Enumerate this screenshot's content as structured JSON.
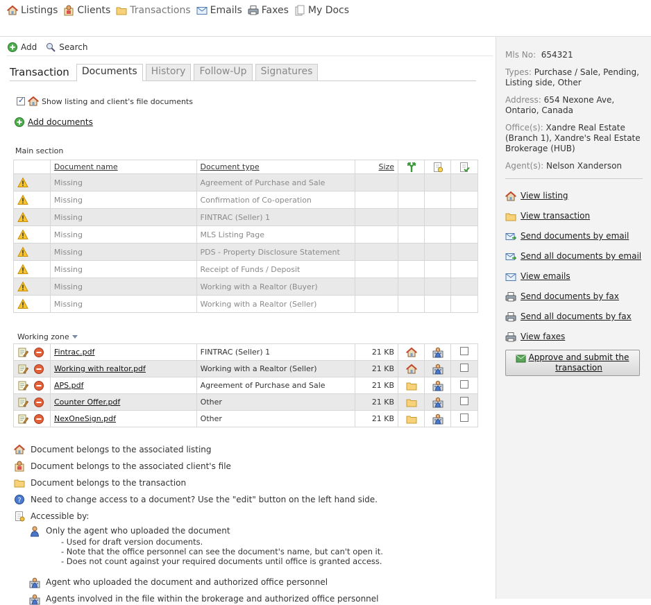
{
  "nav": {
    "items": [
      {
        "label": "Listings",
        "icon": "house-icon"
      },
      {
        "label": "Clients",
        "icon": "client-icon"
      },
      {
        "label": "Transactions",
        "icon": "folder-icon"
      },
      {
        "label": "Emails",
        "icon": "envelope-icon"
      },
      {
        "label": "Faxes",
        "icon": "fax-icon"
      },
      {
        "label": "My Docs",
        "icon": "docs-icon"
      }
    ]
  },
  "toolbar": {
    "add_label": "Add",
    "search_label": "Search"
  },
  "tabs": {
    "title": "Transaction",
    "items": [
      "Documents",
      "History",
      "Follow-Up",
      "Signatures"
    ],
    "active": "Documents"
  },
  "options": {
    "show_label": "Show listing and client's file documents",
    "show_checked": true,
    "add_documents": "Add documents"
  },
  "main_section": {
    "label": "Main section",
    "headers": {
      "name": "Document name",
      "type": "Document type",
      "size": "Size"
    },
    "rows": [
      {
        "name": "Missing",
        "type": "Agreement of Purchase and Sale"
      },
      {
        "name": "Missing",
        "type": "Confirmation of Co-operation"
      },
      {
        "name": "Missing",
        "type": "FINTRAC (Seller) 1"
      },
      {
        "name": "Missing",
        "type": "MLS Listing Page"
      },
      {
        "name": "Missing",
        "type": "PDS - Property Disclosure Statement"
      },
      {
        "name": "Missing",
        "type": "Receipt of Funds / Deposit"
      },
      {
        "name": "Missing",
        "type": "Working with a Realtor (Buyer)"
      },
      {
        "name": "Missing",
        "type": "Working with a Realtor (Seller)"
      }
    ]
  },
  "working_zone": {
    "label": "Working zone",
    "rows": [
      {
        "name": "Fintrac.pdf",
        "type": "FINTRAC (Seller) 1",
        "size": "21 KB",
        "belongs": "house-icon"
      },
      {
        "name": "Working with realtor.pdf",
        "type": "Working with a Realtor (Seller)",
        "size": "21 KB",
        "belongs": "house-icon"
      },
      {
        "name": "APS.pdf",
        "type": "Agreement of Purchase and Sale",
        "size": "21 KB",
        "belongs": "folder-icon"
      },
      {
        "name": "Counter Offer.pdf",
        "type": "Other",
        "size": "21 KB",
        "belongs": "folder-icon"
      },
      {
        "name": "NexOneSign.pdf",
        "type": "Other",
        "size": "21 KB",
        "belongs": "folder-icon"
      }
    ]
  },
  "legend": {
    "listing": "Document belongs to the associated listing",
    "client": "Document belongs to the associated client's file",
    "transaction": "Document belongs to the transaction",
    "access_help": "Need to change access to a document? Use the \"edit\" button on the left hand side.",
    "accessible_by": "Accessible by:",
    "only_agent": "Only the agent who uploaded the document",
    "note1": "- Used for draft version documents.",
    "note2": "- Note that the office personnel can see the document's name, but can't open it.",
    "note3": "- Does not count against your required documents until office is granted access.",
    "agent_office": "Agent who uploaded the document and authorized office personnel",
    "agents_involved": "Agents involved in the file within the brokerage and authorized office personnel"
  },
  "sidebar": {
    "mls_label": "Mls No:",
    "mls_value": "654321",
    "types_label": "Types:",
    "types_value": "Purchase / Sale, Pending, Listing side, Other",
    "address_label": "Address:",
    "address_value": "654 Nexone Ave, Ontario, Canada",
    "offices_label": "Office(s):",
    "offices_value": "Xandre Real Estate (Branch 1), Xandre's Real Estate Brokerage (HUB)",
    "agents_label": "Agent(s):",
    "agents_value": "Nelson Xanderson",
    "links": [
      {
        "label": "View listing",
        "icon": "house-icon"
      },
      {
        "label": "View transaction",
        "icon": "folder-icon"
      },
      {
        "label": "Send documents by email",
        "icon": "email-send-icon"
      },
      {
        "label": "Send all documents by email",
        "icon": "email-send-all-icon"
      },
      {
        "label": "View emails",
        "icon": "envelope-icon"
      },
      {
        "label": "Send documents by fax",
        "icon": "fax-icon"
      },
      {
        "label": "Send all documents by fax",
        "icon": "fax-all-icon"
      },
      {
        "label": "View faxes",
        "icon": "fax-view-icon"
      }
    ],
    "approve_label": "Approve and submit the transaction"
  },
  "colors": {
    "warning": "#f0b400",
    "remove": "#e0502a",
    "add": "#3aa43a",
    "folder": "#f2c14e",
    "house": "#c46a2a"
  }
}
